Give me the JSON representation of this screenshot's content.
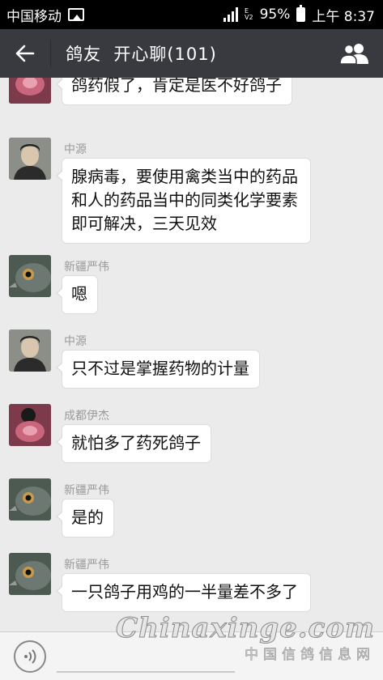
{
  "status_bar": {
    "carrier": "中国移动",
    "net_e": "E",
    "net_v2": "V2",
    "battery_percent": "95%",
    "time": "上午 8:37"
  },
  "header": {
    "title": "鸽友  开心聊(101)",
    "back_icon": "back-arrow-icon",
    "members_icon": "group-members-icon"
  },
  "messages": [
    {
      "sender": "",
      "avatar": "flower-avatar",
      "text": "鸽药假了，肯定是医不好鸽子"
    },
    {
      "sender": "中源",
      "avatar": "man-portrait-avatar",
      "text": "腺病毒，要使用禽类当中的药品和人的药品当中的同类化学要素即可解决，三天见效"
    },
    {
      "sender": "新疆严伟",
      "avatar": "pigeon-avatar",
      "text": "嗯"
    },
    {
      "sender": "中源",
      "avatar": "man-portrait-avatar",
      "text": "只不过是掌握药物的计量"
    },
    {
      "sender": "成都伊杰",
      "avatar": "flower-avatar",
      "text": "就怕多了药死鸽子"
    },
    {
      "sender": "新疆严伟",
      "avatar": "pigeon-avatar",
      "text": "是的"
    },
    {
      "sender": "新疆严伟",
      "avatar": "pigeon-avatar",
      "text": "一只鸽子用鸡的一半量差不多了"
    }
  ],
  "input_bar": {
    "voice_icon": "voice-input-icon"
  },
  "watermark": {
    "main": "Chinaxinge.com",
    "sub": "中国信鸽信息网"
  }
}
